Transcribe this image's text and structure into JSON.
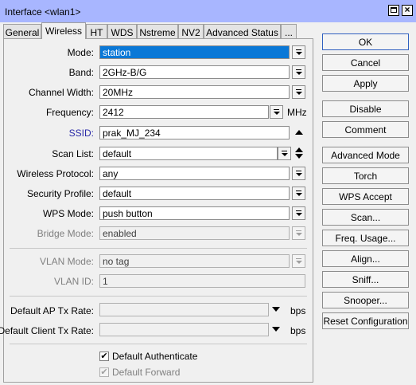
{
  "window": {
    "title": "Interface <wlan1>"
  },
  "tabs": [
    "General",
    "Wireless",
    "HT",
    "WDS",
    "Nstreme",
    "NV2",
    "Advanced Status",
    "..."
  ],
  "active_tab": "Wireless",
  "form": {
    "mode": {
      "label": "Mode:",
      "value": "station"
    },
    "band": {
      "label": "Band:",
      "value": "2GHz-B/G"
    },
    "channel_width": {
      "label": "Channel Width:",
      "value": "20MHz"
    },
    "frequency": {
      "label": "Frequency:",
      "value": "2412",
      "unit": "MHz"
    },
    "ssid": {
      "label": "SSID:",
      "value": "prak_MJ_234"
    },
    "scan_list": {
      "label": "Scan List:",
      "value": "default"
    },
    "wireless_protocol": {
      "label": "Wireless Protocol:",
      "value": "any"
    },
    "security_profile": {
      "label": "Security Profile:",
      "value": "default"
    },
    "wps_mode": {
      "label": "WPS Mode:",
      "value": "push button"
    },
    "bridge_mode": {
      "label": "Bridge Mode:",
      "value": "enabled"
    },
    "vlan_mode": {
      "label": "VLAN Mode:",
      "value": "no tag"
    },
    "vlan_id": {
      "label": "VLAN ID:",
      "value": "1"
    },
    "default_ap_tx_rate": {
      "label": "Default AP Tx Rate:",
      "value": "",
      "unit": "bps"
    },
    "default_client_tx_rate": {
      "label": "Default Client Tx Rate:",
      "value": "",
      "unit": "bps"
    },
    "default_authenticate": {
      "label": "Default Authenticate",
      "checked": true
    },
    "default_forward": {
      "label": "Default Forward",
      "checked": true
    }
  },
  "buttons": [
    "OK",
    "Cancel",
    "Apply",
    "Disable",
    "Comment",
    "Advanced Mode",
    "Torch",
    "WPS Accept",
    "Scan...",
    "Freq. Usage...",
    "Align...",
    "Sniff...",
    "Snooper...",
    "Reset Configuration"
  ],
  "colors": {
    "titlebar": "#a8b6ff",
    "selection": "#0a78d7",
    "ssid_label": "#2a2aa8"
  }
}
